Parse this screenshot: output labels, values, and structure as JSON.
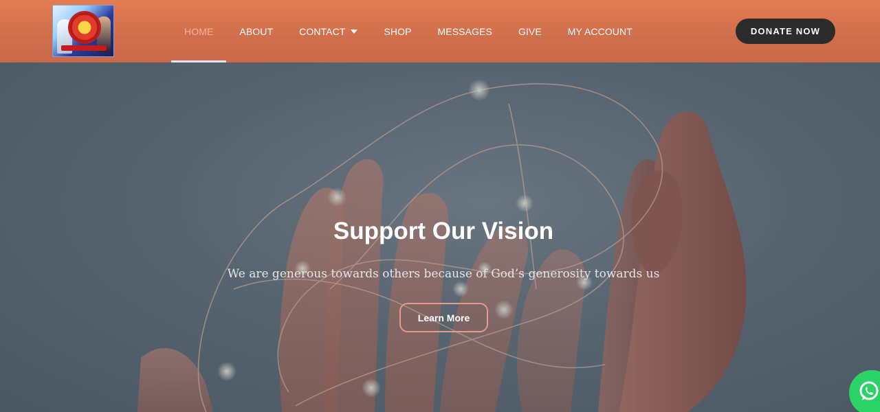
{
  "header": {
    "logo_icon": "church-seal-logo",
    "nav": [
      {
        "label": "HOME",
        "active": true
      },
      {
        "label": "ABOUT"
      },
      {
        "label": "CONTACT",
        "has_dropdown": true
      },
      {
        "label": "SHOP"
      },
      {
        "label": "MESSAGES"
      },
      {
        "label": "GIVE"
      },
      {
        "label": "MY ACCOUNT"
      }
    ],
    "donate_label": "DONATE NOW"
  },
  "hero": {
    "title": "Support Our Vision",
    "subtitle": "We are generous towards others because of God’s generosity towards us",
    "cta_label": "Learn More",
    "background_icon": "hands-with-string-lights"
  },
  "floating": {
    "chat_icon": "whatsapp-icon"
  },
  "colors": {
    "header": "#d8744f",
    "nav_active": "#f3b49a",
    "donate_bg": "#2b2b2b",
    "cta_border": "#e79a8f",
    "whatsapp": "#2bd366"
  }
}
